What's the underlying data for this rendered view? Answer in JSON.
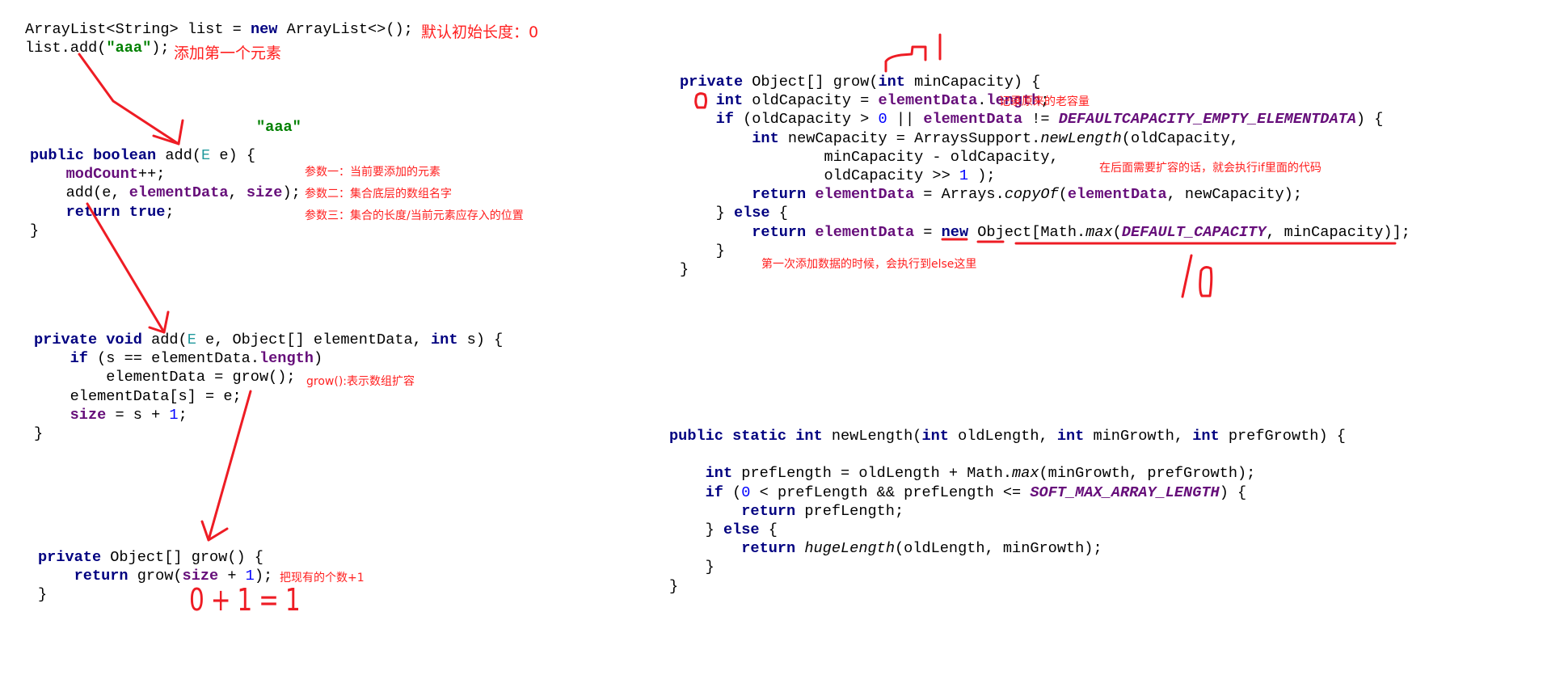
{
  "annotation_color": "#ff0000",
  "blocks": {
    "init": [
      [
        [
          "plain",
          "ArrayList<String> list = "
        ],
        [
          "kw",
          "new"
        ],
        [
          "plain",
          " ArrayList<>();"
        ]
      ],
      [
        [
          "plain",
          "list.add("
        ],
        [
          "str",
          "\"aaa\""
        ],
        [
          "plain",
          ");"
        ]
      ]
    ],
    "add_public": [
      [
        [
          "kw",
          "public boolean"
        ],
        [
          "plain",
          " add("
        ],
        [
          "tp",
          "E"
        ],
        [
          "plain",
          " e) {"
        ]
      ],
      [
        [
          "plain",
          "    "
        ],
        [
          "fld",
          "modCount"
        ],
        [
          "plain",
          "++;"
        ]
      ],
      [
        [
          "plain",
          "    add(e, "
        ],
        [
          "fld",
          "elementData"
        ],
        [
          "plain",
          ", "
        ],
        [
          "fld",
          "size"
        ],
        [
          "plain",
          ");"
        ]
      ],
      [
        [
          "plain",
          "    "
        ],
        [
          "kw",
          "return true"
        ],
        [
          "plain",
          ";"
        ]
      ],
      [
        [
          "plain",
          "}"
        ]
      ]
    ],
    "add_private": [
      [
        [
          "kw",
          "private void"
        ],
        [
          "plain",
          " add("
        ],
        [
          "tp",
          "E"
        ],
        [
          "plain",
          " e, Object[] elementData, "
        ],
        [
          "kw",
          "int"
        ],
        [
          "plain",
          " s) {"
        ]
      ],
      [
        [
          "plain",
          "    "
        ],
        [
          "kw",
          "if"
        ],
        [
          "plain",
          " (s == elementData."
        ],
        [
          "fld",
          "length"
        ],
        [
          "plain",
          ")"
        ]
      ],
      [
        [
          "plain",
          "        elementData = grow();"
        ]
      ],
      [
        [
          "plain",
          "    elementData[s] = e;"
        ]
      ],
      [
        [
          "plain",
          "    "
        ],
        [
          "fld",
          "size"
        ],
        [
          "plain",
          " = s + "
        ],
        [
          "num",
          "1"
        ],
        [
          "plain",
          ";"
        ]
      ],
      [
        [
          "plain",
          "}"
        ]
      ]
    ],
    "grow_noarg": [
      [
        [
          "kw",
          "private"
        ],
        [
          "plain",
          " Object[] grow() {"
        ]
      ],
      [
        [
          "plain",
          "    "
        ],
        [
          "kw",
          "return"
        ],
        [
          "plain",
          " grow("
        ],
        [
          "fld",
          "size"
        ],
        [
          "plain",
          " + "
        ],
        [
          "num",
          "1"
        ],
        [
          "plain",
          ");"
        ]
      ],
      [
        [
          "plain",
          "}"
        ]
      ]
    ],
    "grow_min": [
      [
        [
          "kw",
          "private"
        ],
        [
          "plain",
          " Object[] grow("
        ],
        [
          "kw",
          "int"
        ],
        [
          "plain",
          " minCapacity) {"
        ]
      ],
      [
        [
          "plain",
          "    "
        ],
        [
          "kw",
          "int"
        ],
        [
          "plain",
          " oldCapacity = "
        ],
        [
          "fld",
          "elementData"
        ],
        [
          "plain",
          "."
        ],
        [
          "fld",
          "length"
        ],
        [
          "plain",
          ";"
        ]
      ],
      [
        [
          "plain",
          "    "
        ],
        [
          "kw",
          "if"
        ],
        [
          "plain",
          " (oldCapacity > "
        ],
        [
          "num",
          "0"
        ],
        [
          "plain",
          " || "
        ],
        [
          "fld",
          "elementData"
        ],
        [
          "plain",
          " != "
        ],
        [
          "cst",
          "DEFAULTCAPACITY_EMPTY_ELEMENTDATA"
        ],
        [
          "plain",
          ") {"
        ]
      ],
      [
        [
          "plain",
          "        "
        ],
        [
          "kw",
          "int"
        ],
        [
          "plain",
          " newCapacity = ArraysSupport."
        ],
        [
          "it",
          "newLength"
        ],
        [
          "plain",
          "(oldCapacity,"
        ]
      ],
      [
        [
          "plain",
          "                minCapacity - oldCapacity,"
        ]
      ],
      [
        [
          "plain",
          "                oldCapacity >> "
        ],
        [
          "num",
          "1"
        ],
        [
          "plain",
          " );"
        ]
      ],
      [
        [
          "plain",
          "        "
        ],
        [
          "kw",
          "return"
        ],
        [
          "plain",
          " "
        ],
        [
          "fld",
          "elementData"
        ],
        [
          "plain",
          " = Arrays."
        ],
        [
          "it",
          "copyOf"
        ],
        [
          "plain",
          "("
        ],
        [
          "fld",
          "elementData"
        ],
        [
          "plain",
          ", newCapacity);"
        ]
      ],
      [
        [
          "plain",
          "    } "
        ],
        [
          "kw",
          "else"
        ],
        [
          "plain",
          " {"
        ]
      ],
      [
        [
          "plain",
          "        "
        ],
        [
          "kw",
          "return"
        ],
        [
          "plain",
          " "
        ],
        [
          "fld",
          "elementData"
        ],
        [
          "plain",
          " = "
        ],
        [
          "kw",
          "new"
        ],
        [
          "plain",
          " Object[Math."
        ],
        [
          "it",
          "max"
        ],
        [
          "plain",
          "("
        ],
        [
          "cst",
          "DEFAULT_CAPACITY"
        ],
        [
          "plain",
          ", minCapacity)];"
        ]
      ],
      [
        [
          "plain",
          "    }"
        ]
      ],
      [
        [
          "plain",
          "}"
        ]
      ]
    ],
    "new_length": [
      [
        [
          "kw",
          "public static int"
        ],
        [
          "plain",
          " newLength("
        ],
        [
          "kw",
          "int"
        ],
        [
          "plain",
          " oldLength, "
        ],
        [
          "kw",
          "int"
        ],
        [
          "plain",
          " minGrowth, "
        ],
        [
          "kw",
          "int"
        ],
        [
          "plain",
          " prefGrowth) {"
        ]
      ],
      [
        [
          "plain",
          ""
        ]
      ],
      [
        [
          "plain",
          "    "
        ],
        [
          "kw",
          "int"
        ],
        [
          "plain",
          " prefLength = oldLength + Math."
        ],
        [
          "it",
          "max"
        ],
        [
          "plain",
          "(minGrowth, prefGrowth);"
        ]
      ],
      [
        [
          "plain",
          "    "
        ],
        [
          "kw",
          "if"
        ],
        [
          "plain",
          " ("
        ],
        [
          "num",
          "0"
        ],
        [
          "plain",
          " < prefLength && prefLength <= "
        ],
        [
          "cst",
          "SOFT_MAX_ARRAY_LENGTH"
        ],
        [
          "plain",
          ") {"
        ]
      ],
      [
        [
          "plain",
          "        "
        ],
        [
          "kw",
          "return"
        ],
        [
          "plain",
          " prefLength;"
        ]
      ],
      [
        [
          "plain",
          "    } "
        ],
        [
          "kw",
          "else"
        ],
        [
          "plain",
          " {"
        ]
      ],
      [
        [
          "plain",
          "        "
        ],
        [
          "kw",
          "return"
        ],
        [
          "plain",
          " "
        ],
        [
          "it",
          "hugeLength"
        ],
        [
          "plain",
          "(oldLength, minGrowth);"
        ]
      ],
      [
        [
          "plain",
          "    }"
        ]
      ],
      [
        [
          "plain",
          "}"
        ]
      ]
    ]
  },
  "floating_string": "\"aaa\"",
  "notes": {
    "default_length": "默认初始长度：0",
    "add_first": "添加第一个元素",
    "param1": "参数一：当前要添加的元素",
    "param2": "参数二：集合底层的数组名字",
    "param3": "参数三：集合的长度/当前元素应存入的位置",
    "grow_desc": "grow():表示数组扩容",
    "plus_one": "把现有的个数+1",
    "record_old": "记录原来的老容量",
    "if_branch": "在后面需要扩容的话，就会执行if里面的代码",
    "else_branch": "第一次添加数据的时候，会执行到else这里"
  },
  "handwriting": {
    "size_plus_one": "0 + 1 = 1",
    "min_capacity": "1",
    "new_capacity": "10"
  }
}
